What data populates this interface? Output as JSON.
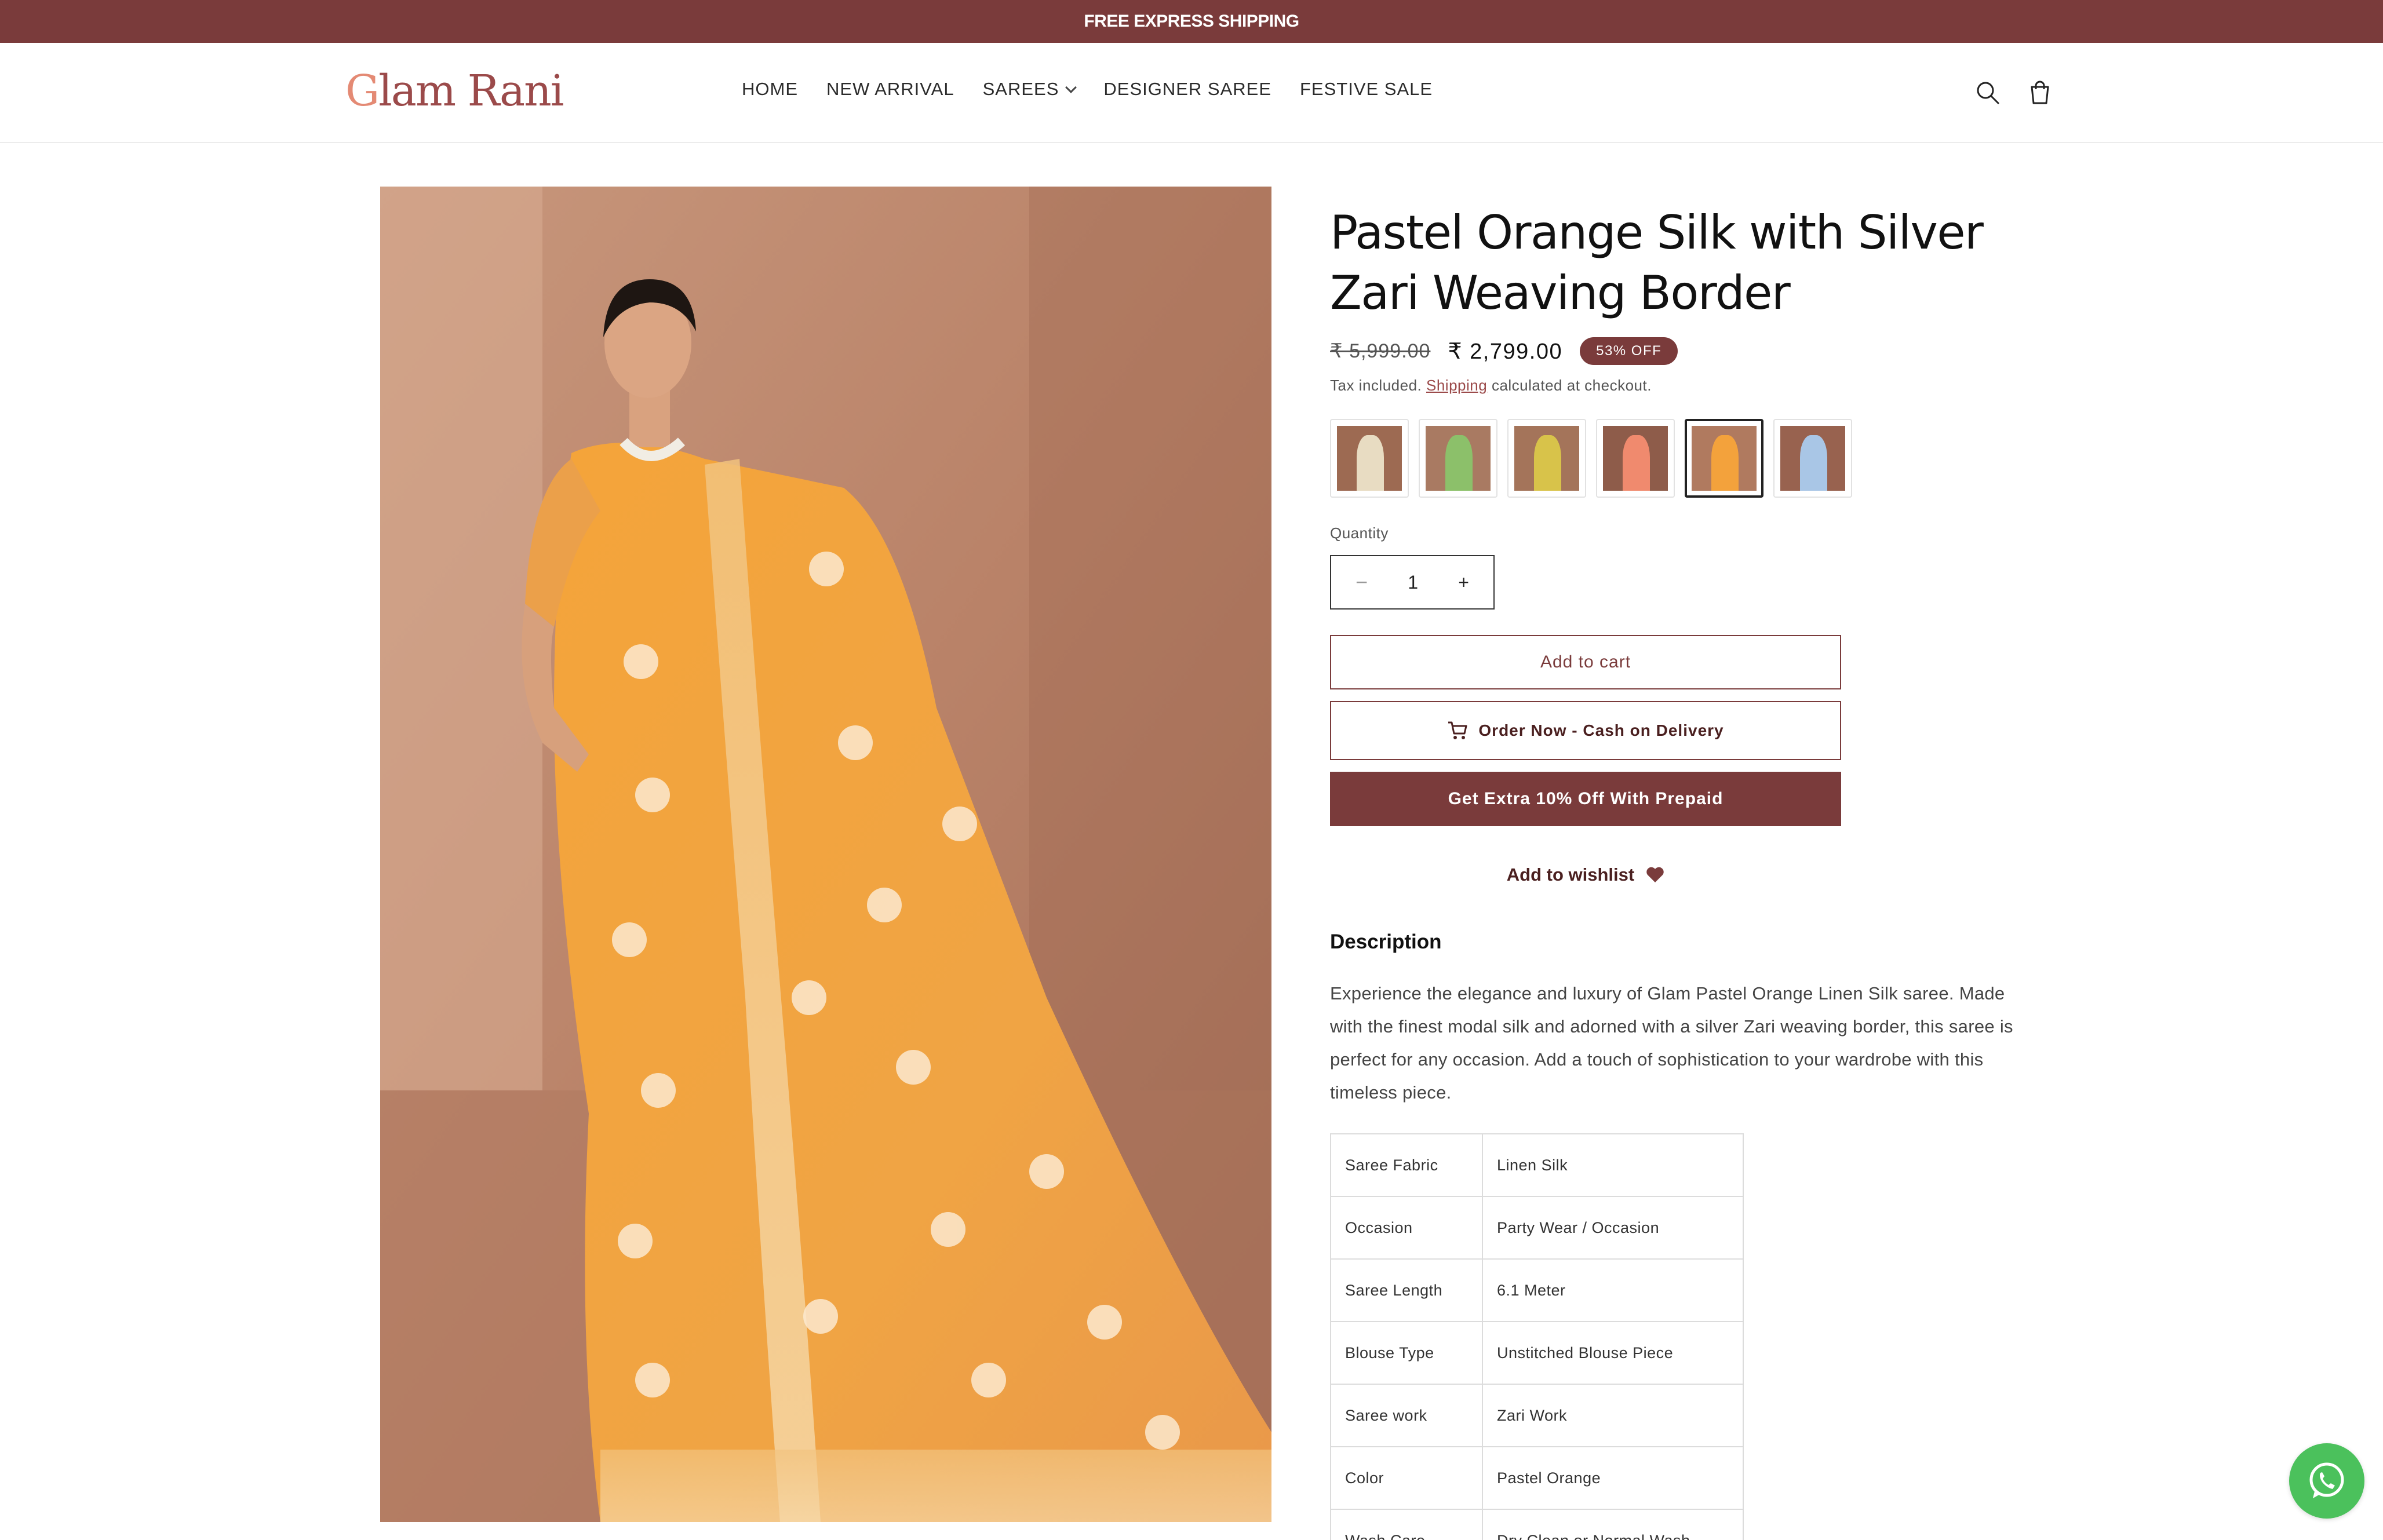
{
  "announcement": {
    "text": "FREE EXPRESS SHIPPING"
  },
  "header": {
    "logo_first": "G",
    "logo_rest": "lam Rani",
    "nav": [
      {
        "label": "HOME"
      },
      {
        "label": "NEW ARRIVAL"
      },
      {
        "label": "SAREES"
      },
      {
        "label": "DESIGNER SAREE"
      },
      {
        "label": "FESTIVE SALE"
      }
    ],
    "icons": [
      "search-icon",
      "cart-icon"
    ]
  },
  "product": {
    "title": "Pastel Orange Silk with Silver Zari Weaving Border",
    "price_old": "₹ 5,999.00",
    "price_new": "₹ 2,799.00",
    "badge": "53% OFF",
    "tax_prefix": "Tax included.",
    "tax_link": "Shipping",
    "tax_suffix": "calculated at checkout.",
    "swatches": [
      {
        "color": "#e8dcc2",
        "selected": false
      },
      {
        "color": "#8cc06a",
        "selected": false
      },
      {
        "color": "#d8c34a",
        "selected": false
      },
      {
        "color": "#f08a6e",
        "selected": false
      },
      {
        "color": "#f3a23c",
        "selected": true
      },
      {
        "color": "#a9c6e6",
        "selected": false
      }
    ],
    "quantity_label": "Quantity",
    "quantity_value": "1",
    "qty_minus": "−",
    "qty_plus": "+",
    "add_to_cart": "Add to cart",
    "order_cod": "Order Now - Cash on Delivery",
    "prepaid": "Get Extra 10% Off With Prepaid",
    "wishlist": "Add to wishlist",
    "description_heading": "Description",
    "description": "Experience the elegance and luxury of Glam Pastel Orange Linen Silk saree. Made with the finest modal silk and adorned with a silver Zari weaving border, this saree is perfect for any occasion. Add a touch of sophistication to your wardrobe with this timeless piece.",
    "specs": [
      {
        "key": "Saree Fabric",
        "value": "Linen Silk"
      },
      {
        "key": "Occasion",
        "value": "Party Wear / Occasion"
      },
      {
        "key": "Saree Length",
        "value": "6.1 Meter"
      },
      {
        "key": "Blouse Type",
        "value": "Unstitched Blouse Piece"
      },
      {
        "key": "Saree work",
        "value": "Zari Work"
      },
      {
        "key": "Color",
        "value": "Pastel Orange"
      },
      {
        "key": "Wash Care",
        "value": "Dry Clean or Normal Wash"
      }
    ]
  },
  "colors": {
    "brand": "#7a3b3b",
    "accent": "#9b4a4a",
    "whatsapp": "#4bc15c"
  }
}
